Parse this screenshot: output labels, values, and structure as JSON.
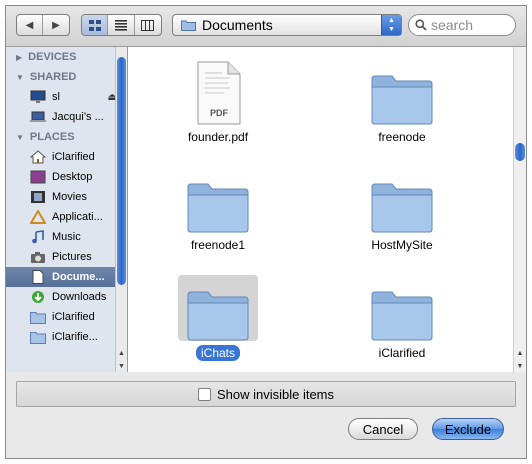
{
  "toolbar": {
    "back_glyph": "◀",
    "forward_glyph": "▶",
    "views": [
      "icon-view",
      "list-view",
      "column-view"
    ],
    "location": "Documents",
    "search_placeholder": "search"
  },
  "sidebar": {
    "sections": [
      {
        "title": "DEVICES",
        "items": []
      },
      {
        "title": "SHARED",
        "items": [
          {
            "label": "sl",
            "icon": "display-icon",
            "eject": true
          },
          {
            "label": "Jacqui’s ...",
            "icon": "laptop-icon"
          }
        ]
      },
      {
        "title": "PLACES",
        "items": [
          {
            "label": "iClarified",
            "icon": "home-icon"
          },
          {
            "label": "Desktop",
            "icon": "desktop-icon"
          },
          {
            "label": "Movies",
            "icon": "film-icon"
          },
          {
            "label": "Applicati...",
            "icon": "applications-icon"
          },
          {
            "label": "Music",
            "icon": "music-note-icon"
          },
          {
            "label": "Pictures",
            "icon": "camera-icon"
          },
          {
            "label": "Docume...",
            "icon": "document-icon",
            "selected": true
          },
          {
            "label": "Downloads",
            "icon": "download-icon"
          },
          {
            "label": "iClarified",
            "icon": "folder-icon"
          },
          {
            "label": "iClarifie...",
            "icon": "folder-icon"
          }
        ]
      }
    ]
  },
  "files": [
    {
      "name": "founder.pdf",
      "kind": "pdf",
      "badge": "PDF"
    },
    {
      "name": "freenode",
      "kind": "folder"
    },
    {
      "name": "freenode1",
      "kind": "folder"
    },
    {
      "name": "HostMySite",
      "kind": "folder"
    },
    {
      "name": "iChats",
      "kind": "folder",
      "selected": true
    },
    {
      "name": "iClarified",
      "kind": "folder"
    }
  ],
  "options": {
    "show_invisible_label": "Show invisible items",
    "show_invisible_checked": false
  },
  "buttons": {
    "cancel": "Cancel",
    "primary": "Exclude"
  },
  "colors": {
    "accent": "#3a75d6",
    "sidebar_bg": "#dfe5ee",
    "selection_sidebar": "#5d769e"
  }
}
